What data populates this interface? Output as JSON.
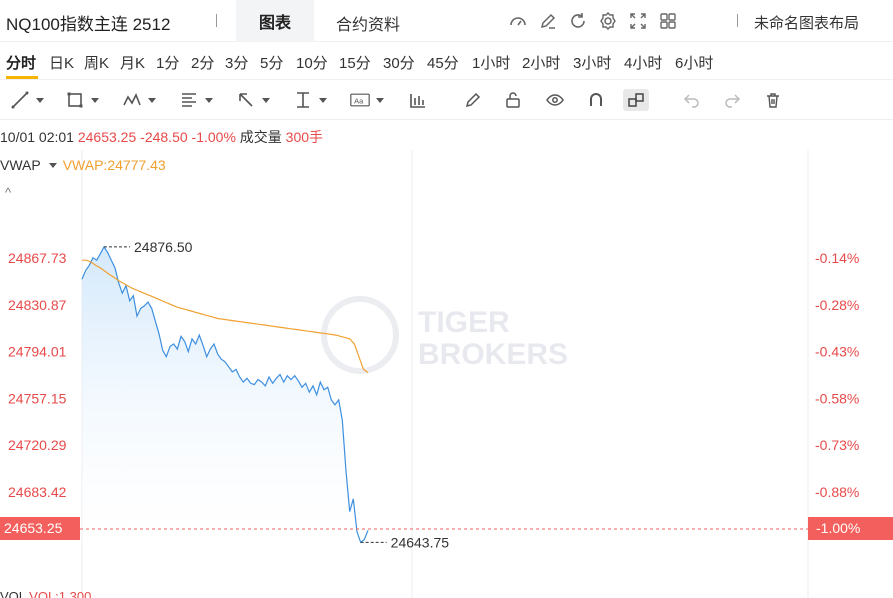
{
  "header": {
    "title": "NQ100指数主连 2512",
    "tab_chart": "图表",
    "tab_contract": "合约资料",
    "layout_name": "未命名图表布局",
    "icons": [
      "speedometer-icon",
      "edit-icon",
      "refresh-icon",
      "gear-icon",
      "fullscreen-icon",
      "grid-layout-icon"
    ]
  },
  "periods": [
    "分时",
    "日K",
    "周K",
    "月K",
    "1分",
    "2分",
    "3分",
    "5分",
    "10分",
    "15分",
    "30分",
    "45分",
    "1小时",
    "2小时",
    "3小时",
    "4小时",
    "6小时"
  ],
  "active_period": "分时",
  "toolbar": [
    "line-tool-icon",
    "rectangle-tool-icon",
    "pattern-tool-icon",
    "fibonacci-tool-icon",
    "arrow-tool-icon",
    "measure-tool-icon",
    "text-tool-icon",
    "indicator-icon",
    "pencil-icon",
    "lock-icon",
    "eye-icon",
    "magnet-icon",
    "link-icon",
    "undo-icon",
    "redo-icon",
    "trash-icon"
  ],
  "info": {
    "datetime": "10/01 02:01",
    "price": "24653.25",
    "change": "-248.50",
    "change_pct": "-1.00%",
    "volume_label": "成交量",
    "volume_value": "300手"
  },
  "vwap": {
    "name": "VWAP",
    "value": "VWAP:24777.43"
  },
  "current": {
    "price_tag": "24653.25",
    "pct_tag": "-1.00%"
  },
  "volume_indicator": {
    "name": "VOL",
    "value": "VOL:1,300"
  },
  "colors": {
    "up": "#e84a4a",
    "price_line": "#3d8fe0",
    "vwap": "#f0a030",
    "tag": "#f25f5c",
    "watermark": "#d9dce3"
  },
  "chart_data": {
    "type": "line",
    "y_ticks_left": [
      "24867.73",
      "24830.87",
      "24794.01",
      "24757.15",
      "24720.29",
      "24683.42"
    ],
    "y_ticks_right": [
      "-0.14%",
      "-0.28%",
      "-0.43%",
      "-0.58%",
      "-0.73%",
      "-0.88%"
    ],
    "ylim": [
      24630,
      24905
    ],
    "prev_close": 24901.75,
    "high_label": "24876.50",
    "low_label": "24643.75",
    "watermark": [
      "TIGER",
      "BROKERS"
    ],
    "series": [
      {
        "values": [
          24851,
          24858,
          24862,
          24868,
          24866,
          24871,
          24876.5,
          24872,
          24866,
          24860,
          24848,
          24840,
          24846,
          24834,
          24838,
          24822,
          24828,
          24830,
          24833,
          24828,
          24818,
          24808,
          24795,
          24790,
          24798,
          24800,
          24796,
          24806,
          24802,
          24794,
          24804,
          24800,
          24807,
          24799,
          24790,
          24796,
          24800,
          24792,
          24788,
          24786,
          24782,
          24778,
          24780,
          24774,
          24770,
          24773,
          24769,
          24768,
          24772,
          24770,
          24767,
          24774,
          24769,
          24773,
          24776,
          24770,
          24775,
          24772,
          24775,
          24771,
          24766,
          24769,
          24762,
          24767,
          24760,
          24770,
          24764,
          24766,
          24756,
          24752,
          24756,
          24740,
          24700,
          24668,
          24678,
          24652,
          24643.75,
          24646,
          24653.25
        ],
        "color": "#3d8fe0"
      },
      {
        "name": "VWAP",
        "values": [
          24866,
          24866,
          24864.5,
          24862,
          24860,
          24857.5,
          24855,
          24852.5,
          24850,
          24848,
          24846,
          24844,
          24842.5,
          24841,
          24839.5,
          24838,
          24836.5,
          24835,
          24833.5,
          24832,
          24830.5,
          24829,
          24828,
          24827,
          24826,
          24825,
          24824,
          24823,
          24822,
          24821,
          24820,
          24819.5,
          24819,
          24818.5,
          24818,
          24817.5,
          24817,
          24816.5,
          24816,
          24815.5,
          24815,
          24814.5,
          24814,
          24813.5,
          24813,
          24812.5,
          24812,
          24811.5,
          24811,
          24810.5,
          24810,
          24809.5,
          24809,
          24808.5,
          24808,
          24807.5,
          24807,
          24806,
          24805,
          24804,
          24800,
          24790,
          24780,
          24777.43
        ],
        "color": "#f0a030"
      }
    ]
  }
}
